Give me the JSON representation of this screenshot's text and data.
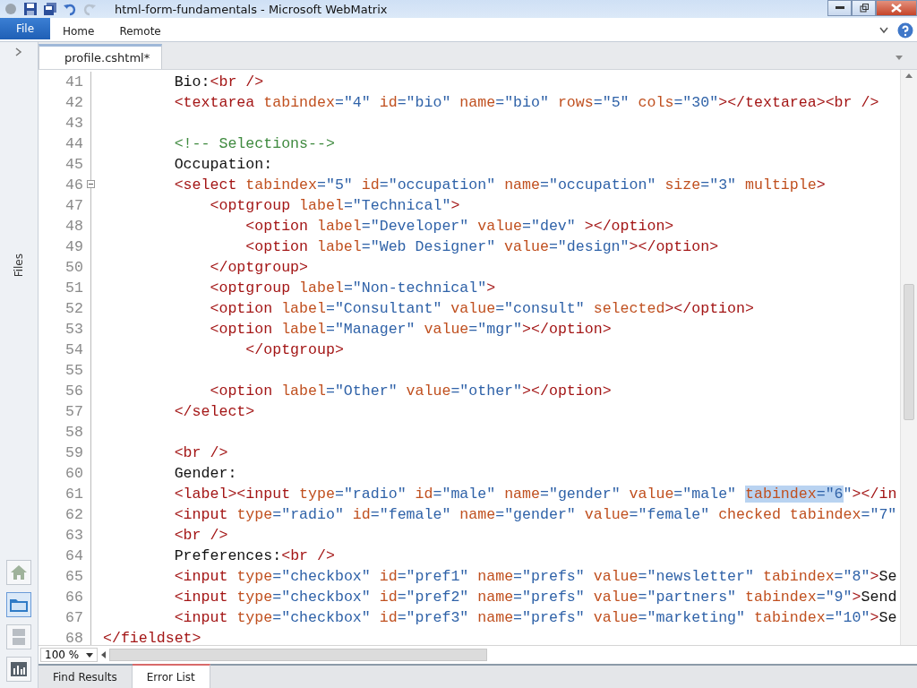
{
  "window": {
    "title": "html-form-fundamentals - Microsoft WebMatrix"
  },
  "ribbon": {
    "file_tab": "File",
    "tabs": [
      {
        "label": "Home",
        "selected": false
      },
      {
        "label": "Remote",
        "selected": false
      }
    ]
  },
  "sidebar": {
    "label": "Files",
    "workspaces": [
      {
        "kind": "home",
        "selected": false
      },
      {
        "kind": "folder",
        "selected": true
      },
      {
        "kind": "database",
        "selected": false
      },
      {
        "kind": "reports",
        "selected": false
      }
    ]
  },
  "document_tabs": [
    {
      "label": "profile.cshtml*",
      "selected": true
    }
  ],
  "editor": {
    "lines": [
      {
        "number": "41",
        "tokens": [
          {
            "kind": "text",
            "text": "        Bio:"
          },
          {
            "kind": "tag",
            "text": "<br />"
          }
        ]
      },
      {
        "number": "42",
        "tokens": [
          {
            "kind": "tag",
            "text": "        <textarea"
          },
          {
            "kind": "attr",
            "text": " tabindex"
          },
          {
            "kind": "value",
            "text": "=\"4\""
          },
          {
            "kind": "attr",
            "text": " id"
          },
          {
            "kind": "value",
            "text": "=\"bio\""
          },
          {
            "kind": "attr",
            "text": " name"
          },
          {
            "kind": "value",
            "text": "=\"bio\""
          },
          {
            "kind": "attr",
            "text": " rows"
          },
          {
            "kind": "value",
            "text": "=\"5\""
          },
          {
            "kind": "attr",
            "text": " cols"
          },
          {
            "kind": "value",
            "text": "=\"30\""
          },
          {
            "kind": "tag",
            "text": "></textarea><br />"
          }
        ]
      },
      {
        "number": "43"
      },
      {
        "number": "44",
        "tokens": [
          {
            "kind": "comment",
            "text": "        <!-- Selections-->"
          }
        ]
      },
      {
        "number": "45",
        "tokens": [
          {
            "kind": "text",
            "text": "        Occupation:"
          }
        ]
      },
      {
        "number": "46",
        "collapsible": true,
        "tokens": [
          {
            "kind": "tag",
            "text": "        <select"
          },
          {
            "kind": "attr",
            "text": " tabindex"
          },
          {
            "kind": "value",
            "text": "=\"5\""
          },
          {
            "kind": "attr",
            "text": " id"
          },
          {
            "kind": "value",
            "text": "=\"occupation\""
          },
          {
            "kind": "attr",
            "text": " name"
          },
          {
            "kind": "value",
            "text": "=\"occupation\""
          },
          {
            "kind": "attr",
            "text": " size"
          },
          {
            "kind": "value",
            "text": "=\"3\""
          },
          {
            "kind": "attr",
            "text": " multiple"
          },
          {
            "kind": "tag",
            "text": ">"
          }
        ]
      },
      {
        "number": "47",
        "tokens": [
          {
            "kind": "tag",
            "text": "            <optgroup"
          },
          {
            "kind": "attr",
            "text": " label"
          },
          {
            "kind": "value",
            "text": "=\"Technical\""
          },
          {
            "kind": "tag",
            "text": ">"
          }
        ]
      },
      {
        "number": "48",
        "tokens": [
          {
            "kind": "tag",
            "text": "                <option"
          },
          {
            "kind": "attr",
            "text": " label"
          },
          {
            "kind": "value",
            "text": "=\"Developer\""
          },
          {
            "kind": "attr",
            "text": " value"
          },
          {
            "kind": "value",
            "text": "=\"dev\""
          },
          {
            "kind": "tag",
            "text": " ></option>"
          }
        ]
      },
      {
        "number": "49",
        "tokens": [
          {
            "kind": "tag",
            "text": "                <option"
          },
          {
            "kind": "attr",
            "text": " label"
          },
          {
            "kind": "value",
            "text": "=\"Web Designer\""
          },
          {
            "kind": "attr",
            "text": " value"
          },
          {
            "kind": "value",
            "text": "=\"design\""
          },
          {
            "kind": "tag",
            "text": "></option>"
          }
        ]
      },
      {
        "number": "50",
        "tokens": [
          {
            "kind": "tag",
            "text": "            </optgroup>"
          }
        ]
      },
      {
        "number": "51",
        "tokens": [
          {
            "kind": "tag",
            "text": "            <optgroup"
          },
          {
            "kind": "attr",
            "text": " label"
          },
          {
            "kind": "value",
            "text": "=\"Non-technical\""
          },
          {
            "kind": "tag",
            "text": ">"
          }
        ]
      },
      {
        "number": "52",
        "tokens": [
          {
            "kind": "tag",
            "text": "            <option"
          },
          {
            "kind": "attr",
            "text": " label"
          },
          {
            "kind": "value",
            "text": "=\"Consultant\""
          },
          {
            "kind": "attr",
            "text": " value"
          },
          {
            "kind": "value",
            "text": "=\"consult\""
          },
          {
            "kind": "attr",
            "text": " selected"
          },
          {
            "kind": "tag",
            "text": "></option>"
          }
        ]
      },
      {
        "number": "53",
        "tokens": [
          {
            "kind": "tag",
            "text": "            <option"
          },
          {
            "kind": "attr",
            "text": " label"
          },
          {
            "kind": "value",
            "text": "=\"Manager\""
          },
          {
            "kind": "attr",
            "text": " value"
          },
          {
            "kind": "value",
            "text": "=\"mgr\""
          },
          {
            "kind": "tag",
            "text": "></option>"
          }
        ]
      },
      {
        "number": "54",
        "tokens": [
          {
            "kind": "tag",
            "text": "                </optgroup>"
          }
        ]
      },
      {
        "number": "55"
      },
      {
        "number": "56",
        "tokens": [
          {
            "kind": "tag",
            "text": "            <option"
          },
          {
            "kind": "attr",
            "text": " label"
          },
          {
            "kind": "value",
            "text": "=\"Other\""
          },
          {
            "kind": "attr",
            "text": " value"
          },
          {
            "kind": "value",
            "text": "=\"other\""
          },
          {
            "kind": "tag",
            "text": "></option>"
          }
        ]
      },
      {
        "number": "57",
        "tokens": [
          {
            "kind": "tag",
            "text": "        </select>"
          }
        ]
      },
      {
        "number": "58"
      },
      {
        "number": "59",
        "tokens": [
          {
            "kind": "tag",
            "text": "        <br />"
          }
        ]
      },
      {
        "number": "60",
        "tokens": [
          {
            "kind": "text",
            "text": "        Gender:"
          }
        ]
      },
      {
        "number": "61",
        "tokens": [
          {
            "kind": "tag",
            "text": "        <label><input",
            "selected": false
          },
          {
            "kind": "attr",
            "text": " type",
            "selected": false
          },
          {
            "kind": "value",
            "text": "=\"radio\"",
            "selected": false
          },
          {
            "kind": "attr",
            "text": " id",
            "selected": false
          },
          {
            "kind": "value",
            "text": "=\"male\"",
            "selected": false
          },
          {
            "kind": "attr",
            "text": " name",
            "selected": false
          },
          {
            "kind": "value",
            "text": "=\"gender\"",
            "selected": false
          },
          {
            "kind": "attr",
            "text": " value",
            "selected": false
          },
          {
            "kind": "value",
            "text": "=\"male\" ",
            "selected": false
          },
          {
            "kind": "attr",
            "text": "tabindex",
            "selected": true
          },
          {
            "kind": "value",
            "text": "=\"6",
            "selected": true
          },
          {
            "kind": "value",
            "text": "\"",
            "selected": false
          },
          {
            "kind": "tag",
            "text": "></in",
            "selected": false
          }
        ]
      },
      {
        "number": "62",
        "tokens": [
          {
            "kind": "tag",
            "text": "        <input"
          },
          {
            "kind": "attr",
            "text": " type"
          },
          {
            "kind": "value",
            "text": "=\"radio\""
          },
          {
            "kind": "attr",
            "text": " id"
          },
          {
            "kind": "value",
            "text": "=\"female\""
          },
          {
            "kind": "attr",
            "text": " name"
          },
          {
            "kind": "value",
            "text": "=\"gender\""
          },
          {
            "kind": "attr",
            "text": " value"
          },
          {
            "kind": "value",
            "text": "=\"female\""
          },
          {
            "kind": "attr",
            "text": " checked tabindex"
          },
          {
            "kind": "value",
            "text": "=\"7\""
          }
        ]
      },
      {
        "number": "63",
        "tokens": [
          {
            "kind": "tag",
            "text": "        <br />"
          }
        ]
      },
      {
        "number": "64",
        "tokens": [
          {
            "kind": "text",
            "text": "        Preferences:"
          },
          {
            "kind": "tag",
            "text": "<br />"
          }
        ]
      },
      {
        "number": "65",
        "tokens": [
          {
            "kind": "tag",
            "text": "        <input"
          },
          {
            "kind": "attr",
            "text": " type"
          },
          {
            "kind": "value",
            "text": "=\"checkbox\""
          },
          {
            "kind": "attr",
            "text": " id"
          },
          {
            "kind": "value",
            "text": "=\"pref1\""
          },
          {
            "kind": "attr",
            "text": " name"
          },
          {
            "kind": "value",
            "text": "=\"prefs\""
          },
          {
            "kind": "attr",
            "text": " value"
          },
          {
            "kind": "value",
            "text": "=\"newsletter\""
          },
          {
            "kind": "attr",
            "text": " tabindex"
          },
          {
            "kind": "value",
            "text": "=\"8\""
          },
          {
            "kind": "tag",
            "text": ">"
          },
          {
            "kind": "text",
            "text": "Se"
          }
        ]
      },
      {
        "number": "66",
        "tokens": [
          {
            "kind": "tag",
            "text": "        <input"
          },
          {
            "kind": "attr",
            "text": " type"
          },
          {
            "kind": "value",
            "text": "=\"checkbox\""
          },
          {
            "kind": "attr",
            "text": " id"
          },
          {
            "kind": "value",
            "text": "=\"pref2\""
          },
          {
            "kind": "attr",
            "text": " name"
          },
          {
            "kind": "value",
            "text": "=\"prefs\""
          },
          {
            "kind": "attr",
            "text": " value"
          },
          {
            "kind": "value",
            "text": "=\"partners\""
          },
          {
            "kind": "attr",
            "text": " tabindex"
          },
          {
            "kind": "value",
            "text": "=\"9\""
          },
          {
            "kind": "tag",
            "text": ">"
          },
          {
            "kind": "text",
            "text": "Send"
          }
        ]
      },
      {
        "number": "67",
        "tokens": [
          {
            "kind": "tag",
            "text": "        <input"
          },
          {
            "kind": "attr",
            "text": " type"
          },
          {
            "kind": "value",
            "text": "=\"checkbox\""
          },
          {
            "kind": "attr",
            "text": " id"
          },
          {
            "kind": "value",
            "text": "=\"pref3\""
          },
          {
            "kind": "attr",
            "text": " name"
          },
          {
            "kind": "value",
            "text": "=\"prefs\""
          },
          {
            "kind": "attr",
            "text": " value"
          },
          {
            "kind": "value",
            "text": "=\"marketing\""
          },
          {
            "kind": "attr",
            "text": " tabindex"
          },
          {
            "kind": "value",
            "text": "=\"10\""
          },
          {
            "kind": "tag",
            "text": ">"
          },
          {
            "kind": "text",
            "text": "Se"
          }
        ]
      },
      {
        "number": "68",
        "tokens": [
          {
            "kind": "tag",
            "text": "</fieldset>"
          }
        ]
      }
    ]
  },
  "zoom": {
    "value": "100 %"
  },
  "bottom_tabs": [
    {
      "label": "Find Results",
      "selected": false
    },
    {
      "label": "Error List",
      "selected": true
    }
  ]
}
